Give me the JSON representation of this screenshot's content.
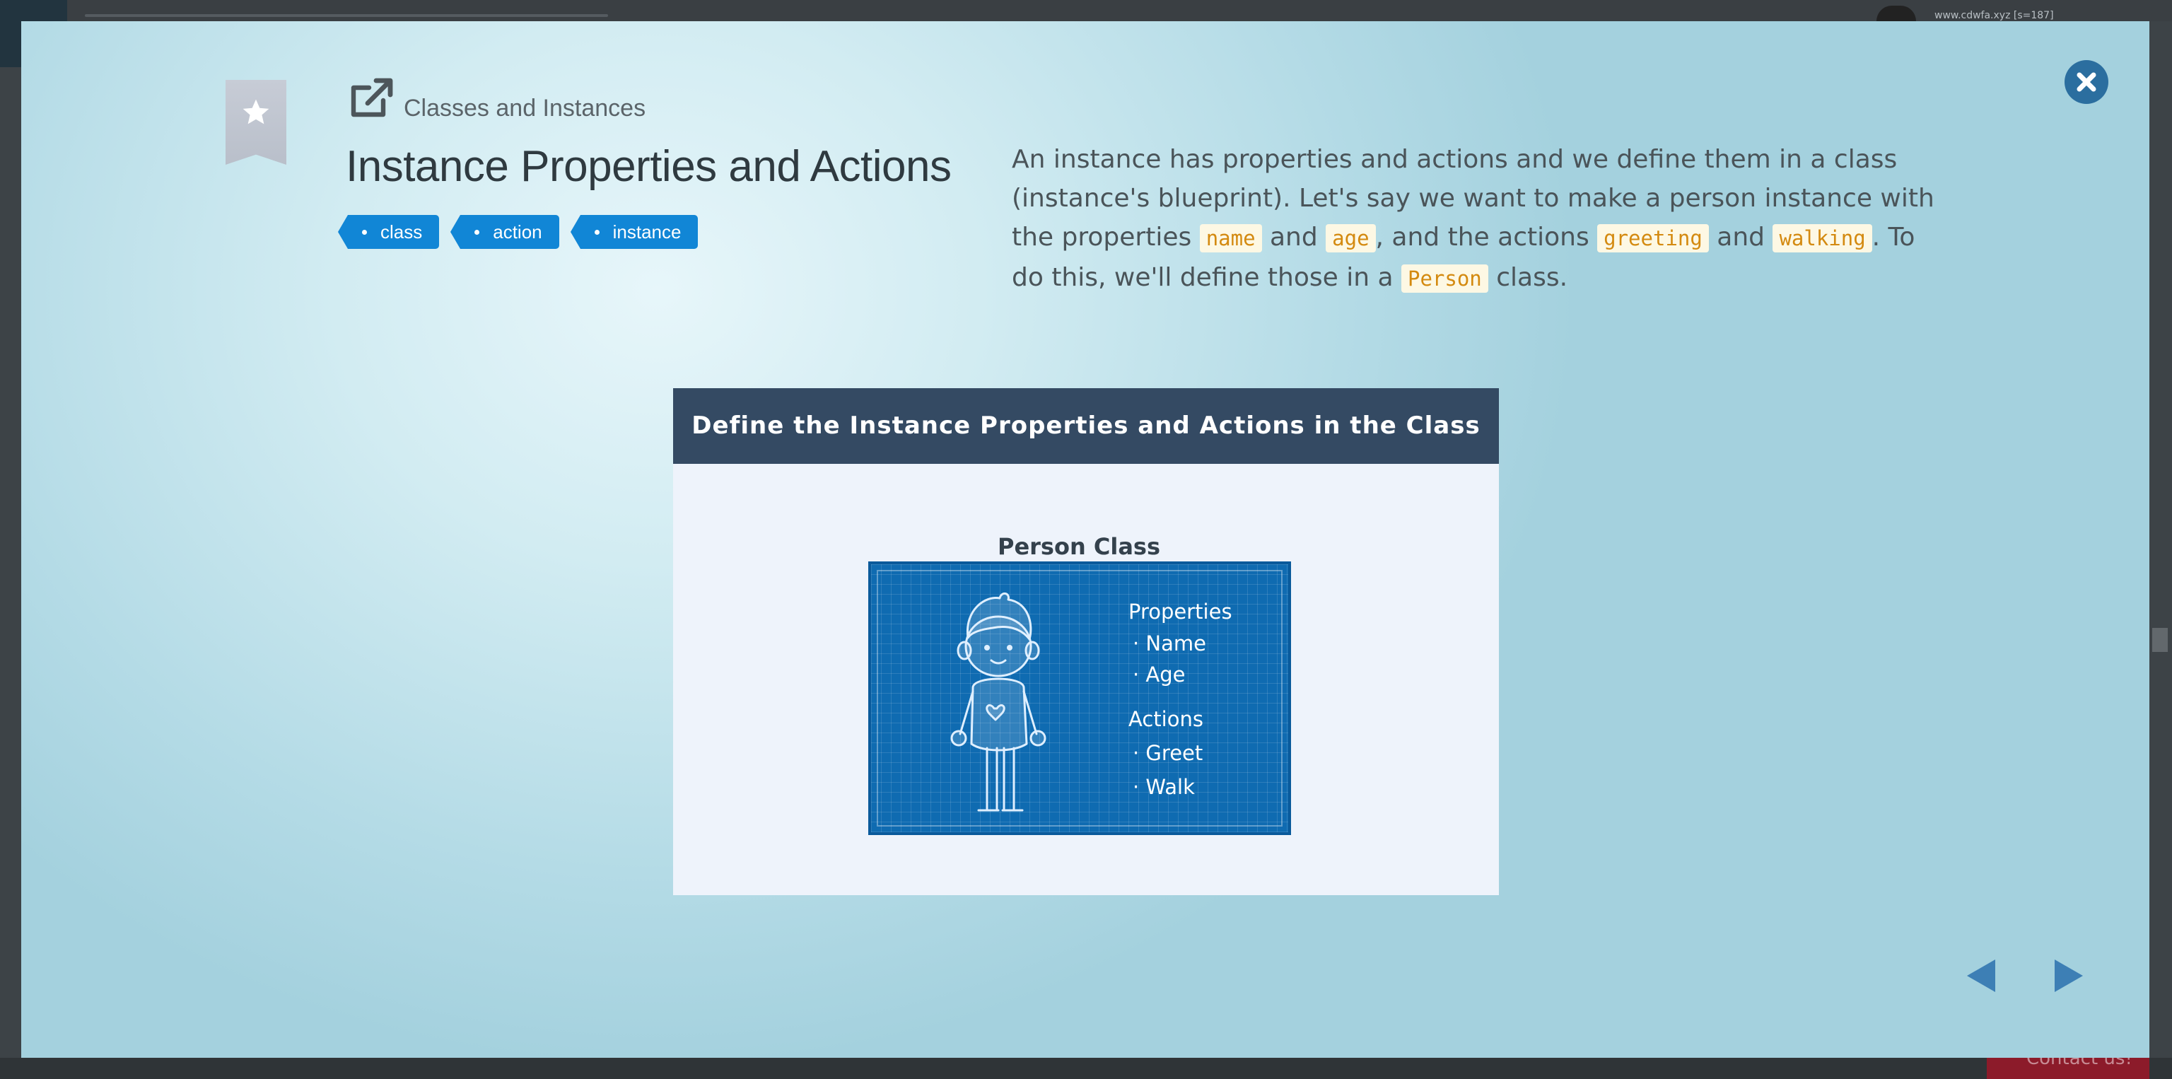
{
  "background": {
    "url_text": "www.cdwfa.xyz [s=187]",
    "contact_label": "Contact us!"
  },
  "modal": {
    "chapter": "Classes and Instances",
    "title": "Instance Properties and Actions",
    "tags": [
      "class",
      "action",
      "instance"
    ],
    "description": {
      "t1": "An instance has properties and actions and we define them in a class (instance's blueprint). Let's say we want to make a person instance with the properties ",
      "c1": "name",
      "t2": " and ",
      "c2": "age",
      "t3": ", and the actions ",
      "c3": "greeting",
      "t4": " and ",
      "c4": "walking",
      "t5": ". To do this, we'll define those in a ",
      "c5": "Person",
      "t6": " class."
    },
    "figure": {
      "header": "Define the Instance Properties and Actions in the Class",
      "subtitle": "Person Class",
      "properties_heading": "Properties",
      "properties": [
        "· Name",
        "· Age"
      ],
      "actions_heading": "Actions",
      "actions": [
        "· Greet",
        "· Walk"
      ]
    },
    "icons": {
      "bookmark": "star-bookmark-icon",
      "external": "external-link-icon",
      "close": "close-icon",
      "prev": "triangle-left-icon",
      "next": "triangle-right-icon"
    },
    "colors": {
      "tag": "#1186d6",
      "header": "#344a63",
      "blueprint": "#0f6bb1",
      "code": "#d48a10"
    }
  }
}
